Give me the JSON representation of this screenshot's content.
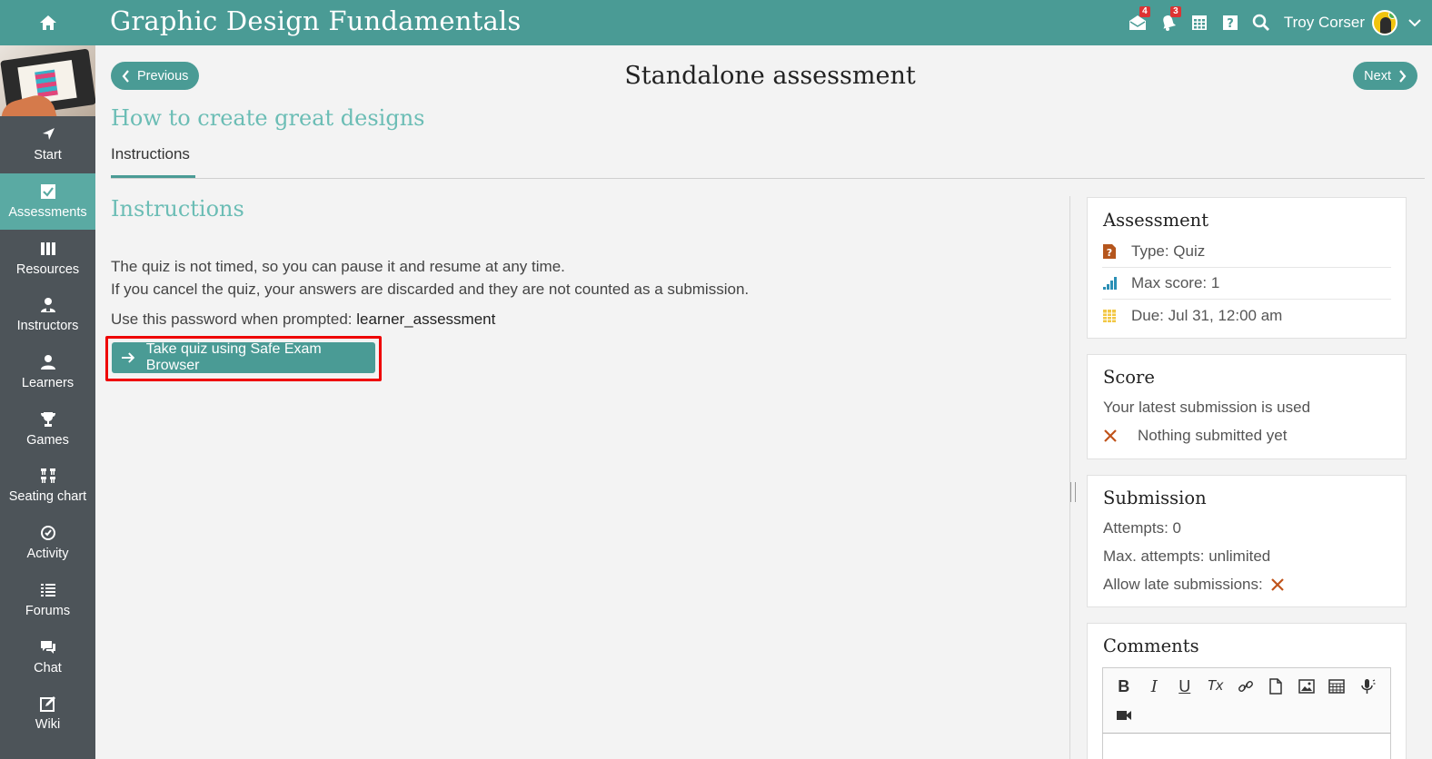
{
  "header": {
    "course_title": "Graphic Design Fundamentals",
    "mail_count": "4",
    "notification_count": "3",
    "user_name": "Troy Corser",
    "icons": [
      "home-icon",
      "mail-icon",
      "bell-icon",
      "calendar-icon",
      "help-icon",
      "search-icon",
      "chevron-down-icon"
    ]
  },
  "sidebar": {
    "items": [
      {
        "label": "Start",
        "icon": "navigation-arrow-icon"
      },
      {
        "label": "Assessments",
        "icon": "checkbox-icon",
        "active": true
      },
      {
        "label": "Resources",
        "icon": "books-icon"
      },
      {
        "label": "Instructors",
        "icon": "instructor-icon"
      },
      {
        "label": "Learners",
        "icon": "learner-icon"
      },
      {
        "label": "Games",
        "icon": "trophy-icon"
      },
      {
        "label": "Seating chart",
        "icon": "seating-chart-icon"
      },
      {
        "label": "Activity",
        "icon": "clock-icon"
      },
      {
        "label": "Forums",
        "icon": "list-icon"
      },
      {
        "label": "Chat",
        "icon": "chat-icon"
      },
      {
        "label": "Wiki",
        "icon": "edit-icon"
      }
    ]
  },
  "page": {
    "previous_label": "Previous",
    "next_label": "Next",
    "title": "Standalone assessment",
    "section_title": "How to create great designs",
    "tab_label": "Instructions"
  },
  "instructions": {
    "heading": "Instructions",
    "line1": "The quiz is not timed, so you can pause it and resume at any time.",
    "line2": "If you cancel the quiz, your answers are discarded and they are not counted as a submission.",
    "password_prefix": "Use this password when prompted:",
    "password": "learner_assessment",
    "quiz_button": "Take quiz using Safe Exam Browser"
  },
  "assessment_card": {
    "title": "Assessment",
    "type": "Type: Quiz",
    "max_score": "Max score: 1",
    "due": "Due: Jul 31, 12:00 am"
  },
  "score_card": {
    "title": "Score",
    "policy": "Your latest submission is used",
    "status": "Nothing submitted yet"
  },
  "submission_card": {
    "title": "Submission",
    "attempts": "Attempts: 0",
    "max_attempts": "Max. attempts: unlimited",
    "late": "Allow late submissions:"
  },
  "comments_card": {
    "title": "Comments",
    "toolbar": [
      "B",
      "I",
      "U",
      "Tx"
    ]
  },
  "colors": {
    "teal": "#4a9b95",
    "teal_light": "#6bbdb5",
    "sidebar": "#4d5459",
    "sidebar_active": "#5aaaa3",
    "badge": "#dd3333",
    "cross": "#c0531a",
    "highlight": "#ee0000"
  }
}
